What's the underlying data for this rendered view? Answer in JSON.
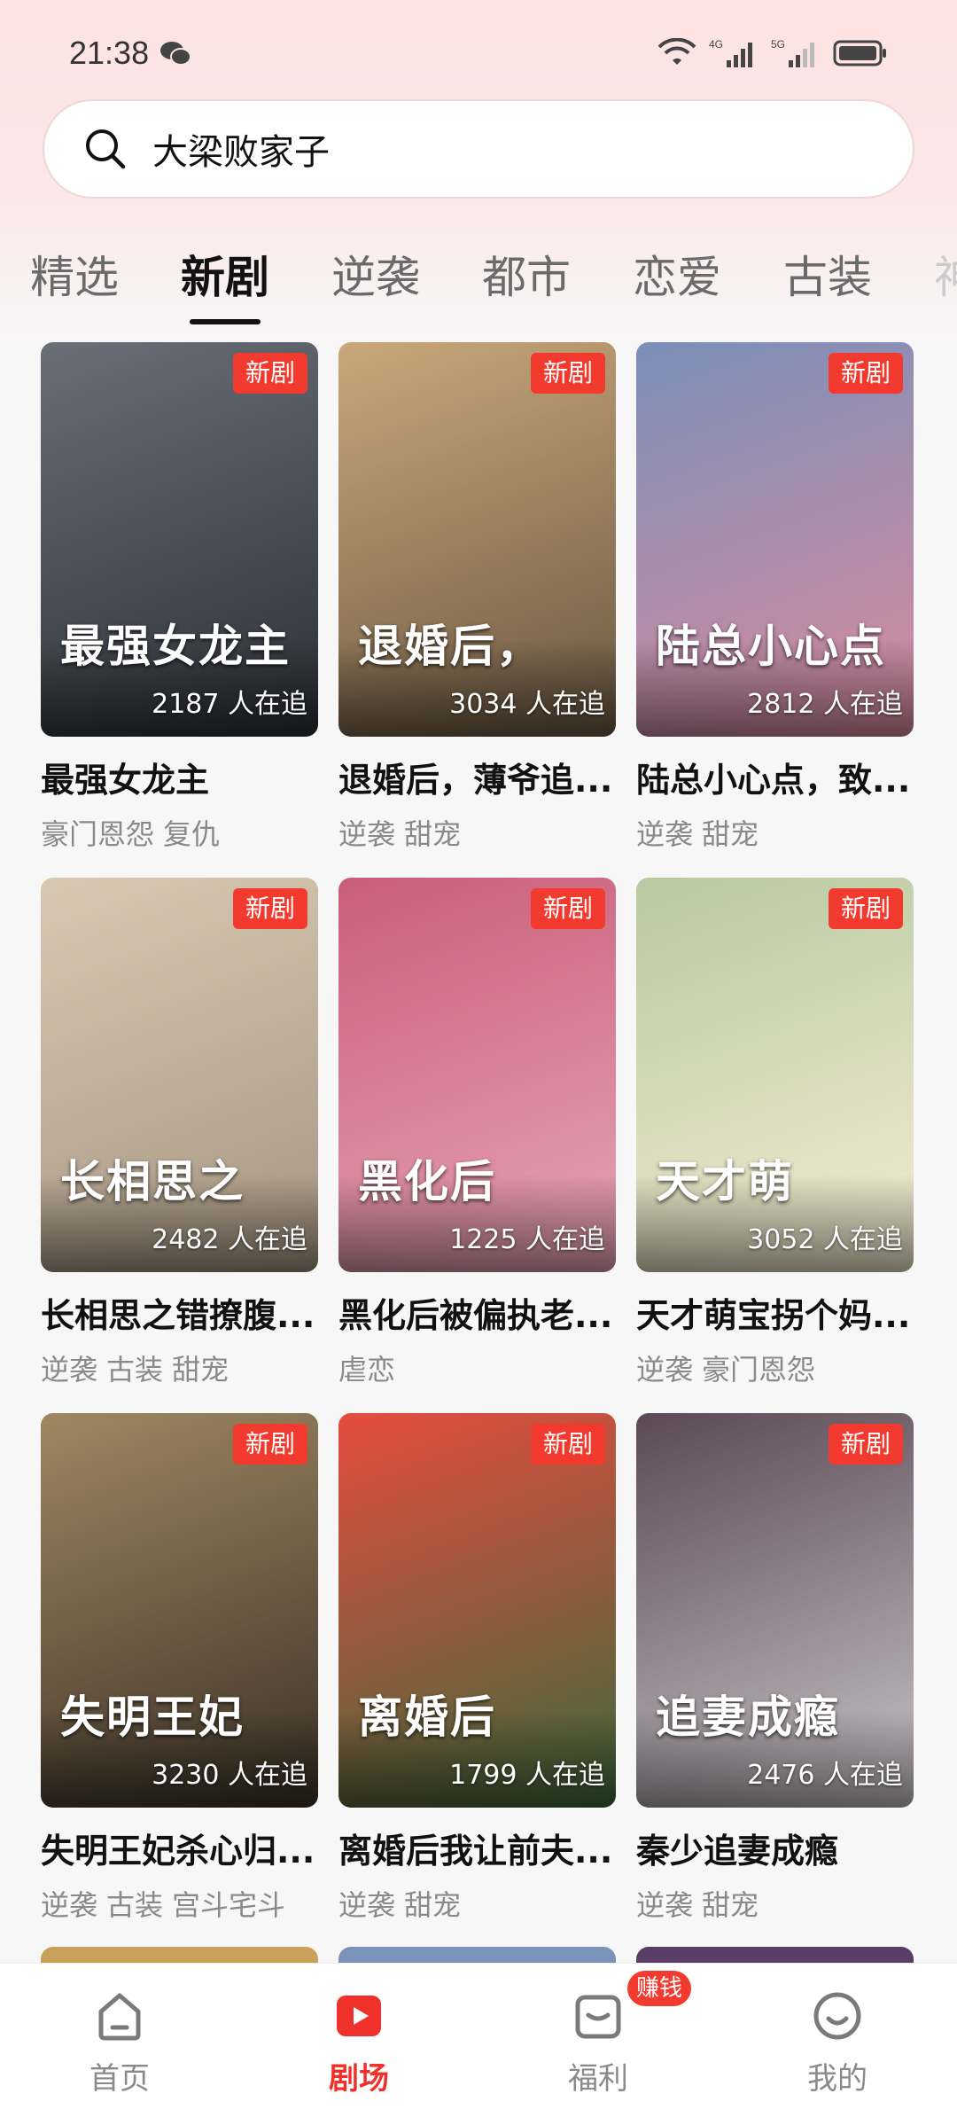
{
  "status_bar": {
    "time": "21:38",
    "signal_labels": [
      "4G",
      "5G"
    ]
  },
  "search": {
    "query": "大梁败家子"
  },
  "tabs": [
    {
      "label": "精选"
    },
    {
      "label": "新剧",
      "active": true
    },
    {
      "label": "逆袭"
    },
    {
      "label": "都市"
    },
    {
      "label": "恋爱"
    },
    {
      "label": "古装"
    },
    {
      "label": "神"
    }
  ],
  "cards": [
    {
      "badge": "新剧",
      "watching": "2187 人在追",
      "poster_title": "最强女龙主",
      "title": "最强女龙主",
      "tags": [
        "豪门恩怨",
        "复仇"
      ],
      "colors": [
        "#2c2f36",
        "#6a6f78"
      ]
    },
    {
      "badge": "新剧",
      "watching": "3034 人在追",
      "poster_title": "退婚后，",
      "title": "退婚后，薄爷追...",
      "tags": [
        "逆袭",
        "甜宠"
      ],
      "colors": [
        "#6b5842",
        "#c9a77a"
      ]
    },
    {
      "badge": "新剧",
      "watching": "2812 人在追",
      "poster_title": "陆总小心点",
      "title": "陆总小心点，致...",
      "tags": [
        "逆袭",
        "甜宠"
      ],
      "colors": [
        "#d98b9f",
        "#7a8fb8"
      ]
    },
    {
      "badge": "新剧",
      "watching": "2482 人在追",
      "poster_title": "长相思之",
      "title": "长相思之错撩腹...",
      "tags": [
        "逆袭",
        "古装",
        "甜宠"
      ],
      "colors": [
        "#a59581",
        "#d7c9b2"
      ]
    },
    {
      "badge": "新剧",
      "watching": "1225 人在追",
      "poster_title": "黑化后",
      "title": "黑化后被偏执老...",
      "tags": [
        "虐恋"
      ],
      "colors": [
        "#e8a4b6",
        "#c85e78"
      ]
    },
    {
      "badge": "新剧",
      "watching": "3052 人在追",
      "poster_title": "天才萌",
      "title": "天才萌宝拐个妈...",
      "tags": [
        "逆袭",
        "豪门恩怨"
      ],
      "colors": [
        "#f4ecd2",
        "#b7c9a1"
      ]
    },
    {
      "badge": "新剧",
      "watching": "3230 人在追",
      "poster_title": "失明王妃",
      "title": "失明王妃杀心归...",
      "tags": [
        "逆袭",
        "古装",
        "宫斗宅斗"
      ],
      "colors": [
        "#3b3126",
        "#a08763"
      ]
    },
    {
      "badge": "新剧",
      "watching": "1799 人在追",
      "poster_title": "离婚后",
      "title": "离婚后我让前夫...",
      "tags": [
        "逆袭",
        "甜宠"
      ],
      "colors": [
        "#3e6a3b",
        "#e64c3f"
      ]
    },
    {
      "badge": "新剧",
      "watching": "2476 人在追",
      "poster_title": "追妻成瘾",
      "title": "秦少追妻成瘾",
      "tags": [
        "逆袭",
        "甜宠"
      ],
      "colors": [
        "#c9c4c7",
        "#5b4a55"
      ]
    }
  ],
  "bottom_nav": [
    {
      "label": "首页",
      "icon": "home-icon"
    },
    {
      "label": "剧场",
      "icon": "theater-play-icon",
      "active": true
    },
    {
      "label": "福利",
      "icon": "welfare-icon",
      "badge": "赚钱"
    },
    {
      "label": "我的",
      "icon": "profile-icon"
    }
  ],
  "accent_color": "#f0302a"
}
